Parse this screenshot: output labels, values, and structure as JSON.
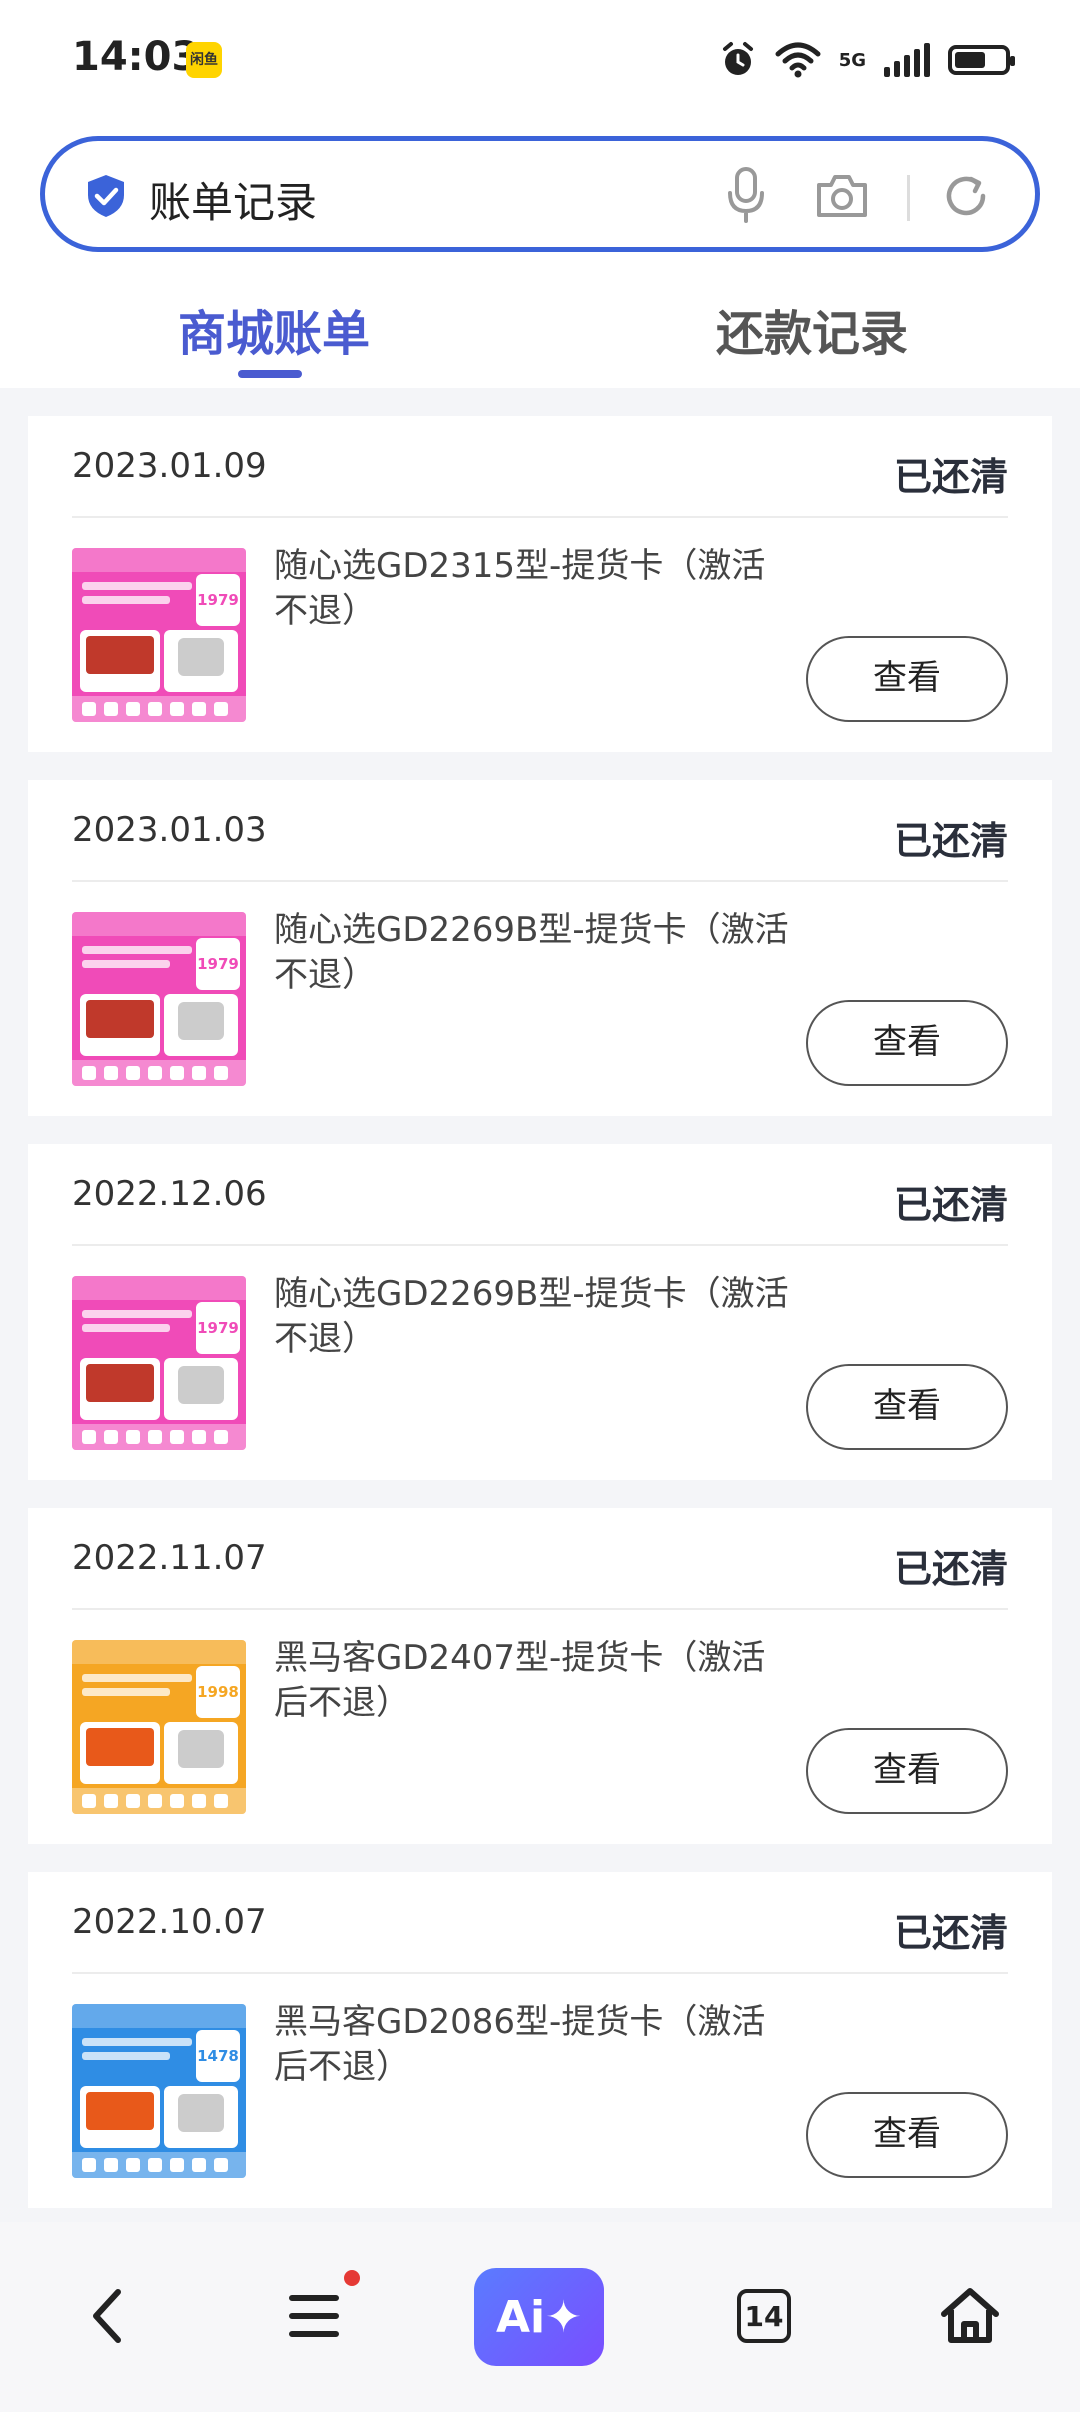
{
  "status_bar": {
    "time": "14:03",
    "badge": "闲鱼",
    "network": "5G"
  },
  "search": {
    "query": "账单记录"
  },
  "tabs": [
    {
      "label": "商城账单"
    },
    {
      "label": "还款记录"
    }
  ],
  "records": [
    {
      "date": "2023.01.09",
      "status": "已还清",
      "title": "随心选GD2315型-提货卡（激活不退）",
      "price": "1979",
      "theme": "#f04bb8",
      "action": "查看"
    },
    {
      "date": "2023.01.03",
      "status": "已还清",
      "title": "随心选GD2269B型-提货卡（激活不退）",
      "price": "1979",
      "theme": "#f04bb8",
      "action": "查看"
    },
    {
      "date": "2022.12.06",
      "status": "已还清",
      "title": "随心选GD2269B型-提货卡（激活不退）",
      "price": "1979",
      "theme": "#f04bb8",
      "action": "查看"
    },
    {
      "date": "2022.11.07",
      "status": "已还清",
      "title": "黑马客GD2407型-提货卡（激活后不退）",
      "price": "1998",
      "theme": "#f5a623",
      "action": "查看"
    },
    {
      "date": "2022.10.07",
      "status": "已还清",
      "title": "黑马客GD2086型-提货卡（激活后不退）",
      "price": "1478",
      "theme": "#2f8de4",
      "action": "查看"
    }
  ],
  "bottom_nav": {
    "ai_label": "Ai✦",
    "tab_count": "14"
  },
  "colors": {
    "accent": "#4a5bd0",
    "search_border": "#3b63d9",
    "ai_gradient_start": "#5a7cff",
    "ai_gradient_end": "#7a4dff"
  },
  "icons": [
    "shield-check-icon",
    "microphone-icon",
    "camera-icon",
    "refresh-icon",
    "back-icon",
    "menu-icon",
    "tabs-icon",
    "home-icon",
    "alarm-icon",
    "wifi-icon",
    "signal-icon",
    "battery-icon"
  ]
}
